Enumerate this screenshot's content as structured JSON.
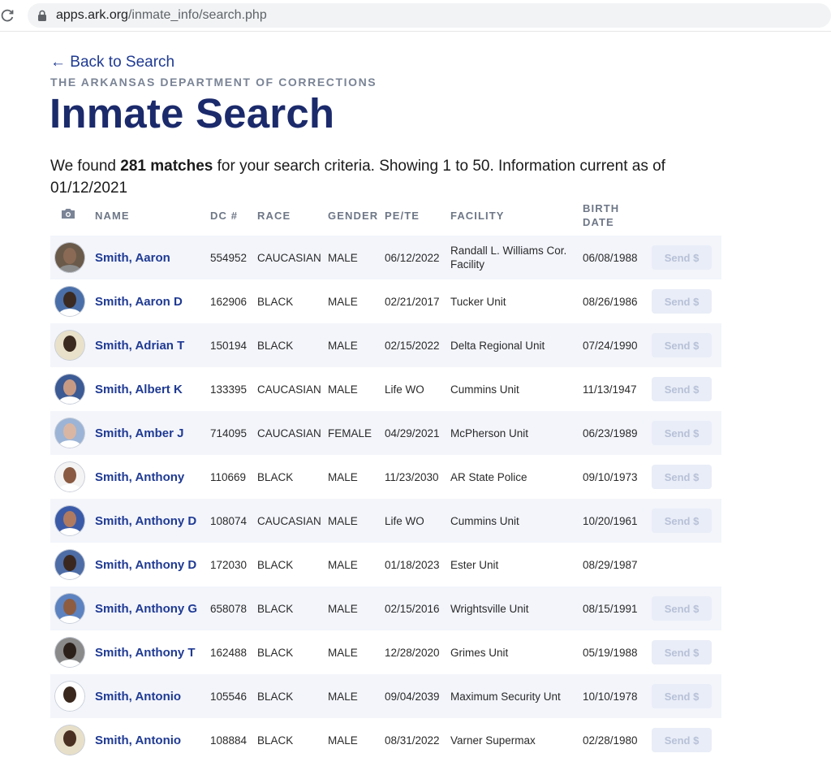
{
  "browser": {
    "url_host": "apps.ark.org",
    "url_path": "/inmate_info/search.php"
  },
  "header": {
    "back_label": "← Back to Search",
    "department": "THE ARKANSAS DEPARTMENT OF CORRECTIONS",
    "title": "Inmate Search",
    "summary_prefix": "We found ",
    "summary_count": "281 matches",
    "summary_suffix": " for your search criteria. Showing 1 to 50. Information current as of 01/12/2021"
  },
  "table": {
    "columns": {
      "photo_icon": "camera-icon",
      "name": "NAME",
      "dc": "DC #",
      "race": "RACE",
      "gender": "GENDER",
      "pete": "PE/TE",
      "facility": "FACILITY",
      "birth_date": "BIRTH DATE"
    },
    "send_label": "Send $",
    "rows": [
      {
        "name": "Smith, Aaron",
        "dc": "554952",
        "race": "CAUCASIAN",
        "gender": "MALE",
        "pete": "06/12/2022",
        "facility": "Randall L. Williams Cor. Facility",
        "birth": "06/08/1988",
        "send": true,
        "skin": "#8a6a55",
        "bg": "#6a5a4a",
        "shirt": "#8c8c8c"
      },
      {
        "name": "Smith, Aaron D",
        "dc": "162906",
        "race": "BLACK",
        "gender": "MALE",
        "pete": "02/21/2017",
        "facility": "Tucker Unit",
        "birth": "08/26/1986",
        "send": true,
        "skin": "#3a2a22",
        "bg": "#4a6fa8",
        "shirt": "#ffffff"
      },
      {
        "name": "Smith, Adrian T",
        "dc": "150194",
        "race": "BLACK",
        "gender": "MALE",
        "pete": "02/15/2022",
        "facility": "Delta Regional Unit",
        "birth": "07/24/1990",
        "send": true,
        "skin": "#3b2a20",
        "bg": "#e9e1c9",
        "shirt": "#e9e1c9"
      },
      {
        "name": "Smith, Albert K",
        "dc": "133395",
        "race": "CAUCASIAN",
        "gender": "MALE",
        "pete": "Life WO",
        "facility": "Cummins Unit",
        "birth": "11/13/1947",
        "send": true,
        "skin": "#c89a84",
        "bg": "#3c5a94",
        "shirt": "#ffffff"
      },
      {
        "name": "Smith, Amber J",
        "dc": "714095",
        "race": "CAUCASIAN",
        "gender": "FEMALE",
        "pete": "04/29/2021",
        "facility": "McPherson Unit",
        "birth": "06/23/1989",
        "send": true,
        "skin": "#d9b6a3",
        "bg": "#9cb4d6",
        "shirt": "#ffffff"
      },
      {
        "name": "Smith, Anthony",
        "dc": "110669",
        "race": "BLACK",
        "gender": "MALE",
        "pete": "11/23/2030",
        "facility": "AR State Police",
        "birth": "09/10/1973",
        "send": true,
        "skin": "#8a5a42",
        "bg": "#f4f4f4",
        "shirt": "#ffffff"
      },
      {
        "name": "Smith, Anthony D",
        "dc": "108074",
        "race": "CAUCASIAN",
        "gender": "MALE",
        "pete": "Life WO",
        "facility": "Cummins Unit",
        "birth": "10/20/1961",
        "send": true,
        "skin": "#b07a60",
        "bg": "#3a5aa8",
        "shirt": "#ffffff"
      },
      {
        "name": "Smith, Anthony D",
        "dc": "172030",
        "race": "BLACK",
        "gender": "MALE",
        "pete": "01/18/2023",
        "facility": "Ester Unit",
        "birth": "08/29/1987",
        "send": false,
        "skin": "#3a2820",
        "bg": "#4e6da6",
        "shirt": "#ffffff"
      },
      {
        "name": "Smith, Anthony G",
        "dc": "658078",
        "race": "BLACK",
        "gender": "MALE",
        "pete": "02/15/2016",
        "facility": "Wrightsville Unit",
        "birth": "08/15/1991",
        "send": true,
        "skin": "#8e5c40",
        "bg": "#5c82c0",
        "shirt": "#ffffff"
      },
      {
        "name": "Smith, Anthony T",
        "dc": "162488",
        "race": "BLACK",
        "gender": "MALE",
        "pete": "12/28/2020",
        "facility": "Grimes Unit",
        "birth": "05/19/1988",
        "send": true,
        "skin": "#2c201a",
        "bg": "#8a8a8a",
        "shirt": "#ffffff"
      },
      {
        "name": "Smith, Antonio",
        "dc": "105546",
        "race": "BLACK",
        "gender": "MALE",
        "pete": "09/04/2039",
        "facility": "Maximum Security Unt",
        "birth": "10/10/1978",
        "send": true,
        "skin": "#3a281e",
        "bg": "#ffffff",
        "shirt": "#ffffff"
      },
      {
        "name": "Smith, Antonio",
        "dc": "108884",
        "race": "BLACK",
        "gender": "MALE",
        "pete": "08/31/2022",
        "facility": "Varner Supermax",
        "birth": "02/28/1980",
        "send": true,
        "skin": "#4a3020",
        "bg": "#e7dfc8",
        "shirt": "#e7dfc8"
      }
    ]
  },
  "colors": {
    "brand_navy": "#1b2a6b",
    "link_blue": "#1f3a93",
    "row_stripe": "#f3f5fb",
    "button_bg": "#e9edf7",
    "button_text": "#b7c1d8"
  }
}
